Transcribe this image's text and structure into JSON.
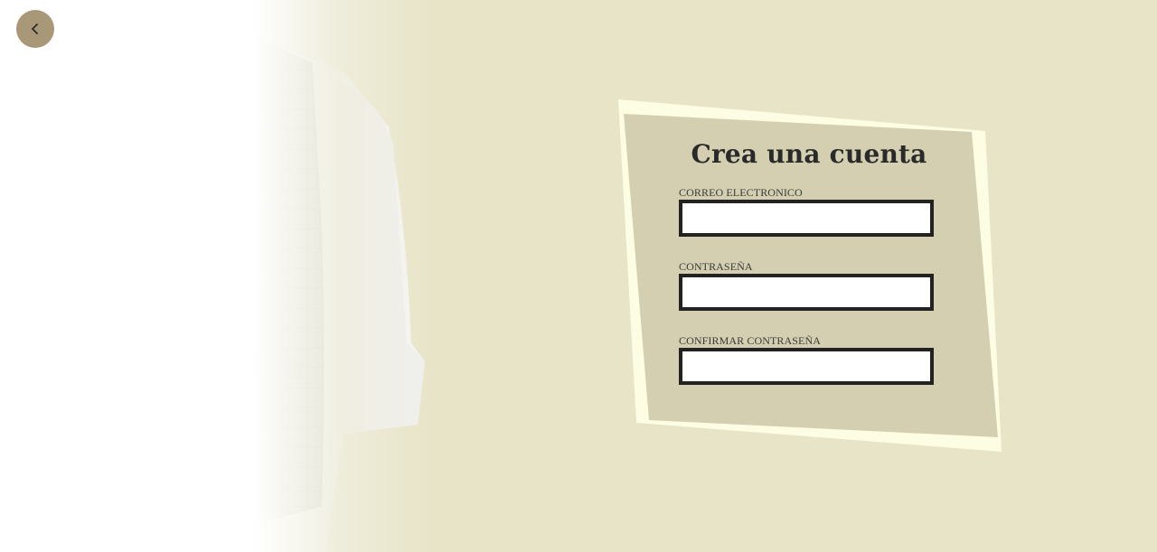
{
  "page": {
    "background_color": "#e8e4c8"
  },
  "back_button": {
    "icon": "chevron-left-icon",
    "color": "#a89878"
  },
  "hero": {
    "image": "vest-with-shirt-and-tie"
  },
  "form": {
    "title": "Crea una cuenta",
    "card_color": "#d3cfb0",
    "card_border_color": "#fdfde4",
    "fields": [
      {
        "label": "CORREO ELECTRONICO",
        "value": "",
        "placeholder": ""
      },
      {
        "label": "CONTRASEÑA",
        "value": "",
        "placeholder": ""
      },
      {
        "label": "CONFIRMAR CONTRASEÑA",
        "value": "",
        "placeholder": ""
      }
    ]
  }
}
